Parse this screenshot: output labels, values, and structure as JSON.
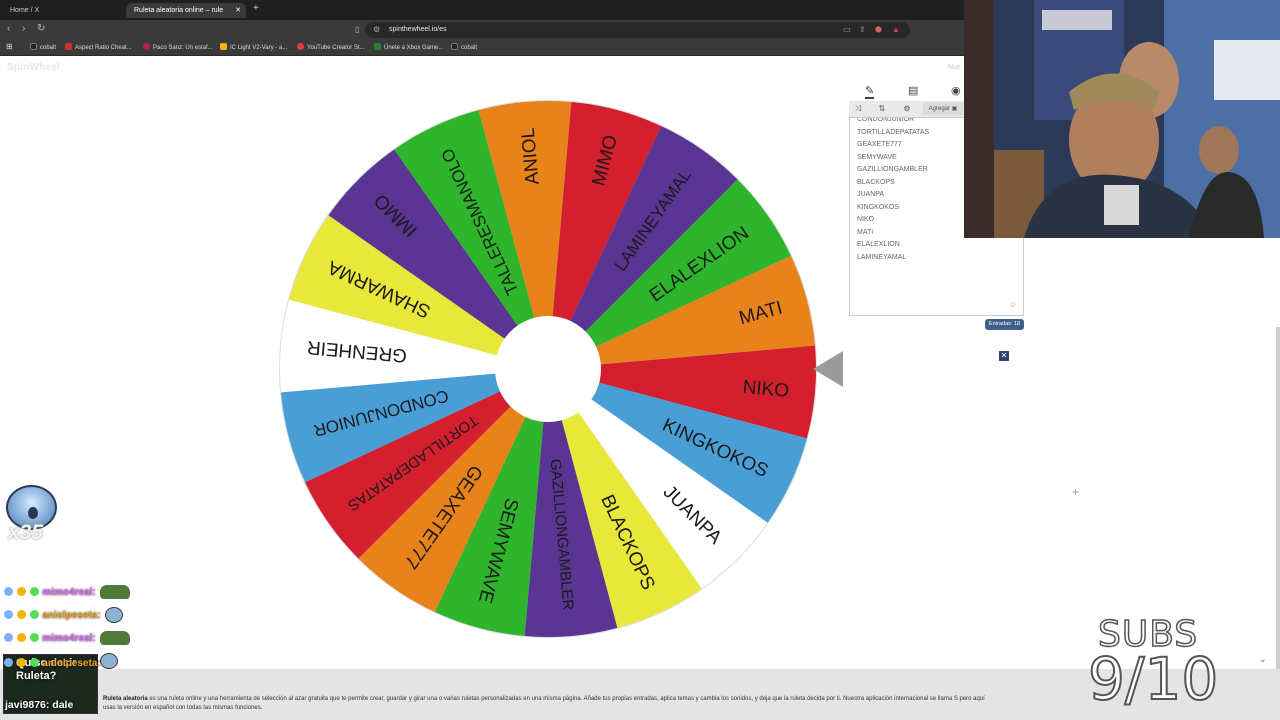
{
  "browser": {
    "tabs": [
      {
        "label": "Home / X"
      },
      {
        "label": "Ruleta aleatoria online – rule"
      }
    ],
    "url": "spinthewheel.io/es",
    "bookmarks": [
      {
        "label": "cobalt",
        "color": "#222222"
      },
      {
        "label": "Aspect Ratio Cheat...",
        "color": "#d32f2f"
      },
      {
        "label": "Paco Sanz: Un estaf...",
        "color": "#c2185b"
      },
      {
        "label": "IC Light V2-Vary - a...",
        "color": "#f4b400"
      },
      {
        "label": "YouTube Creator St...",
        "color": "#e53935"
      },
      {
        "label": "Únete a Xbox Game...",
        "color": "#2e7d32"
      },
      {
        "label": "cobalt",
        "color": "#222222"
      }
    ]
  },
  "site": {
    "logo": "SpinWheel",
    "corner_text": "Nue"
  },
  "wheel": {
    "colors": {
      "orange": "#E8821A",
      "red": "#D41F2F",
      "purple": "#5A3594",
      "green": "#2FB52C",
      "yellow": "#E8E83A",
      "white": "#FFFFFF",
      "blue": "#4A9ED6"
    },
    "segments": [
      {
        "label": "MATI",
        "color": "orange"
      },
      {
        "label": "NIKO",
        "color": "red"
      },
      {
        "label": "KINGKOKOS",
        "color": "blue"
      },
      {
        "label": "JUANPA",
        "color": "white"
      },
      {
        "label": "BLACKOPS",
        "color": "yellow"
      },
      {
        "label": "GAZILLIONGAMBLER",
        "color": "purple"
      },
      {
        "label": "SEMYWAVE",
        "color": "green"
      },
      {
        "label": "GEAXETE777",
        "color": "orange"
      },
      {
        "label": "TORTILLADEPATATAS",
        "color": "red"
      },
      {
        "label": "CONDONJUNIOR",
        "color": "blue"
      },
      {
        "label": "GRENHEIR",
        "color": "white"
      },
      {
        "label": "SHAWARMA",
        "color": "yellow"
      },
      {
        "label": "IMMO",
        "color": "purple"
      },
      {
        "label": "TALLERESMANOLO",
        "color": "green"
      },
      {
        "label": "ANIOL",
        "color": "orange"
      },
      {
        "label": "MIMO",
        "color": "red"
      },
      {
        "label": "LAMINEYAMAL",
        "color": "purple"
      },
      {
        "label": "ELALEXLION",
        "color": "green"
      }
    ]
  },
  "panel": {
    "add_label": "Agregar",
    "entries": [
      "CONDONJUNIOR",
      "TORTILLADEPATATAS",
      "GEAXETE777",
      "SEMYWAVE",
      "GAZILLIONGAMBLER",
      "BLACKOPS",
      "JUANPA",
      "KINGKOKOS",
      "NIKO",
      "MATI",
      "ELALEXLION",
      "LAMINEYAMAL"
    ],
    "count_label": "Entradas: 18"
  },
  "footer": {
    "brand": "Ruleta aleatoria",
    "text": "es una ruleta online y una herramienta de selección al azar gratuita que te permite crear, guardar y girar una o varias ruletas personalizadas en una misma página. Añade tus propias entradas, aplica temas y cambia los sonidos, y deja que la ruleta decida por ti. Nuestra aplicación internacional se llama S",
    "text2": "pero aquí",
    "text3": "usas la versión en español con todas las mismas funciones."
  },
  "overlay": {
    "emote_count": "x35",
    "chat": [
      {
        "user": "mimo4real:",
        "color": "#e06cff"
      },
      {
        "user": "aniolpeseta:",
        "color": "#f5a623"
      },
      {
        "user": "mimo4real:",
        "color": "#e06cff"
      },
      {
        "user": "aniolpeseta:",
        "color": "#f5a623"
      }
    ],
    "alert_quote": "Quiso decir Ruleta?",
    "alert_user": "javi9876:",
    "alert_text": "dale",
    "subs_label": "SUBS",
    "subs_count": "9/10"
  }
}
